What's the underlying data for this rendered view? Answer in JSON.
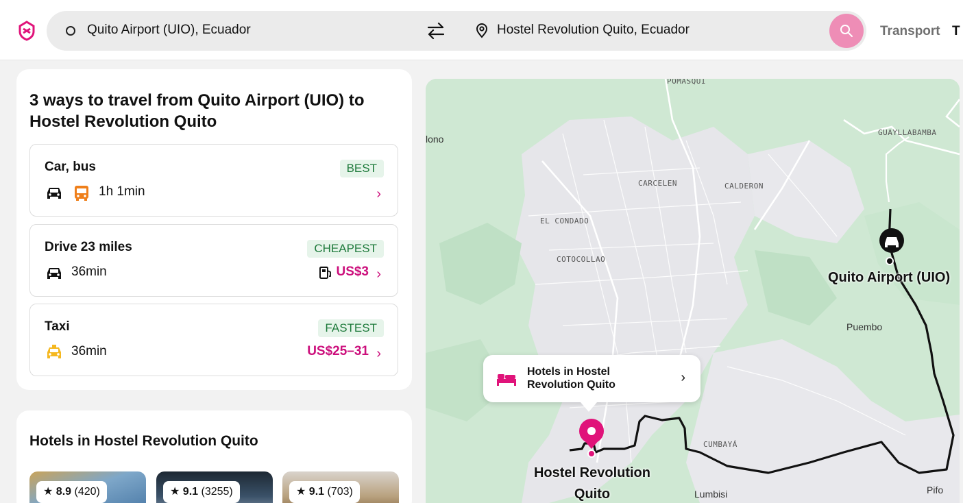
{
  "header": {
    "logo": "rome2rio-logo-icon",
    "origin": "Quito Airport (UIO), Ecuador",
    "destination": "Hostel Revolution Quito, Ecuador",
    "nav": [
      "Transport",
      "T"
    ],
    "accent_color": "#e0137a"
  },
  "routes": {
    "title": "3 ways to travel from Quito Airport (UIO) to Hostel Revolution Quito",
    "options": [
      {
        "name": "Car, bus",
        "tag": "BEST",
        "duration": "1h 1min",
        "price": "",
        "icons": [
          "car-icon",
          "bus-icon"
        ]
      },
      {
        "name": "Drive 23 miles",
        "tag": "CHEAPEST",
        "duration": "36min",
        "price": "US$3",
        "icons": [
          "car-icon",
          "fuel-icon"
        ]
      },
      {
        "name": "Taxi",
        "tag": "FASTEST",
        "duration": "36min",
        "price": "US$25–31",
        "icons": [
          "taxi-icon"
        ]
      }
    ]
  },
  "hotels": {
    "title": "Hotels in Hostel Revolution Quito",
    "items": [
      {
        "rating": "8.9",
        "reviews": "(420)"
      },
      {
        "rating": "9.1",
        "reviews": "(3255)"
      },
      {
        "rating": "9.1",
        "reviews": "(703)"
      }
    ]
  },
  "map": {
    "areas": [
      "POMASQUI",
      "GUAYLLABAMBA",
      "CARCELEN",
      "CALDERON",
      "EL CONDADO",
      "COTOCOLLAO",
      "CUMBAYÁ"
    ],
    "places": [
      "Puembo",
      "Pifo",
      "Lumbisi",
      "lono"
    ],
    "airport_label": "Quito Airport (UIO)",
    "hostel_label": "Hostel Revolution Quito",
    "popup": "Hotels in Hostel Revolution Quito"
  }
}
